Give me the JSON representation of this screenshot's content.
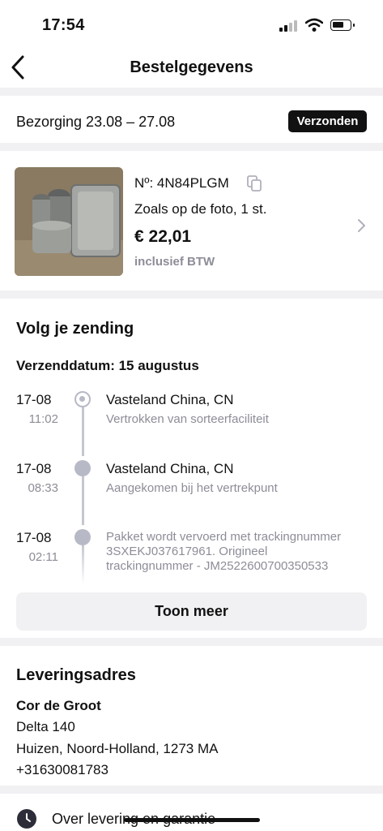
{
  "status_bar": {
    "time": "17:54"
  },
  "header": {
    "title": "Bestelgegevens"
  },
  "delivery": {
    "text": "Bezorging 23.08 – 27.08",
    "badge": "Verzonden"
  },
  "product": {
    "order_number": "Nº: 4N84PLGM",
    "variant": "Zoals op de foto, 1 st.",
    "price": "€ 22,01",
    "vat_note": "inclusief BTW"
  },
  "tracking": {
    "title": "Volg je zending",
    "ship_date": "Verzenddatum: 15 augustus",
    "events": [
      {
        "date": "17-08",
        "time": "11:02",
        "location": "Vasteland China, CN",
        "description": "Vertrokken van sorteerfaciliteit"
      },
      {
        "date": "17-08",
        "time": "08:33",
        "location": "Vasteland China, CN",
        "description": "Aangekomen bij het vertrekpunt"
      },
      {
        "date": "17-08",
        "time": "02:11",
        "location": "",
        "description_lines": [
          "Pakket wordt vervoerd met trackingnummer",
          "3SXEKJ037617961. Origineel",
          "trackingnummer - JM2522600700350533"
        ]
      }
    ],
    "show_more": "Toon meer"
  },
  "address": {
    "title": "Leveringsadres",
    "name": "Cor de Groot",
    "street": "Delta 140",
    "city": "Huizen, Noord-Holland, 1273 MA",
    "phone": "+31630081783"
  },
  "footer": {
    "delivery_guarantee": "Over levering en garantie"
  },
  "colors": {
    "badge_bg": "#111111",
    "muted": "#8d8d98",
    "timeline": "#b8b9c6",
    "background": "#f1f1f4"
  }
}
